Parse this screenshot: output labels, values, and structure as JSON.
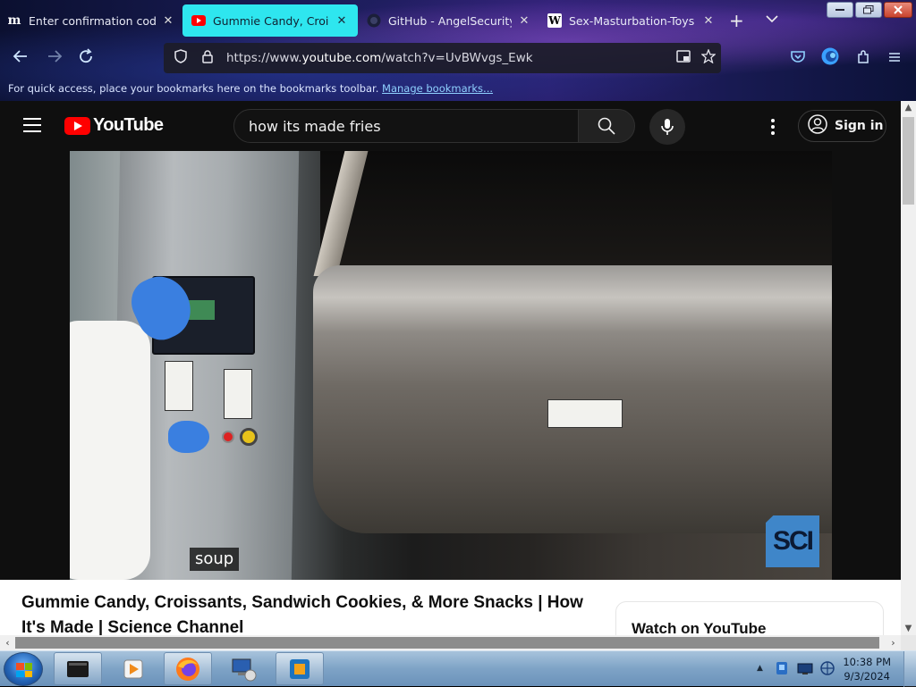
{
  "browser": {
    "tabs": [
      {
        "title": "Enter confirmation code | M",
        "favicon": "m",
        "active": false
      },
      {
        "title": "Gummie Candy, Croissant",
        "favicon": "youtube-icon",
        "active": true
      },
      {
        "title": "GitHub - AngelSecurityTea",
        "favicon": "github-icon",
        "active": false
      },
      {
        "title": "Sex-Masturbation-Toys Co",
        "favicon": "W",
        "active": false
      }
    ],
    "url_prefix": "https://www.",
    "url_domain": "youtube.com",
    "url_path": "/watch?v=UvBWvgs_Ewk",
    "bookmarks_hint": "For quick access, place your bookmarks here on the bookmarks toolbar.",
    "manage_bookmarks": "Manage bookmarks..."
  },
  "youtube": {
    "wordmark": "YouTube",
    "search_query": "how its made fries",
    "sign_in": "Sign in",
    "video": {
      "caption": "soup",
      "watermark": "SCI",
      "title": "Gummie Candy, Croissants, Sandwich Cookies, & More Snacks | How It's Made | Science Channel"
    },
    "watch_on_youtube": "Watch on YouTube"
  },
  "taskbar": {
    "time": "10:38 PM",
    "date": "9/3/2024"
  },
  "colors": {
    "active_tab": "#2ee6ef",
    "youtube_red": "#ff0000",
    "yt_dark": "#0f0f0f"
  }
}
